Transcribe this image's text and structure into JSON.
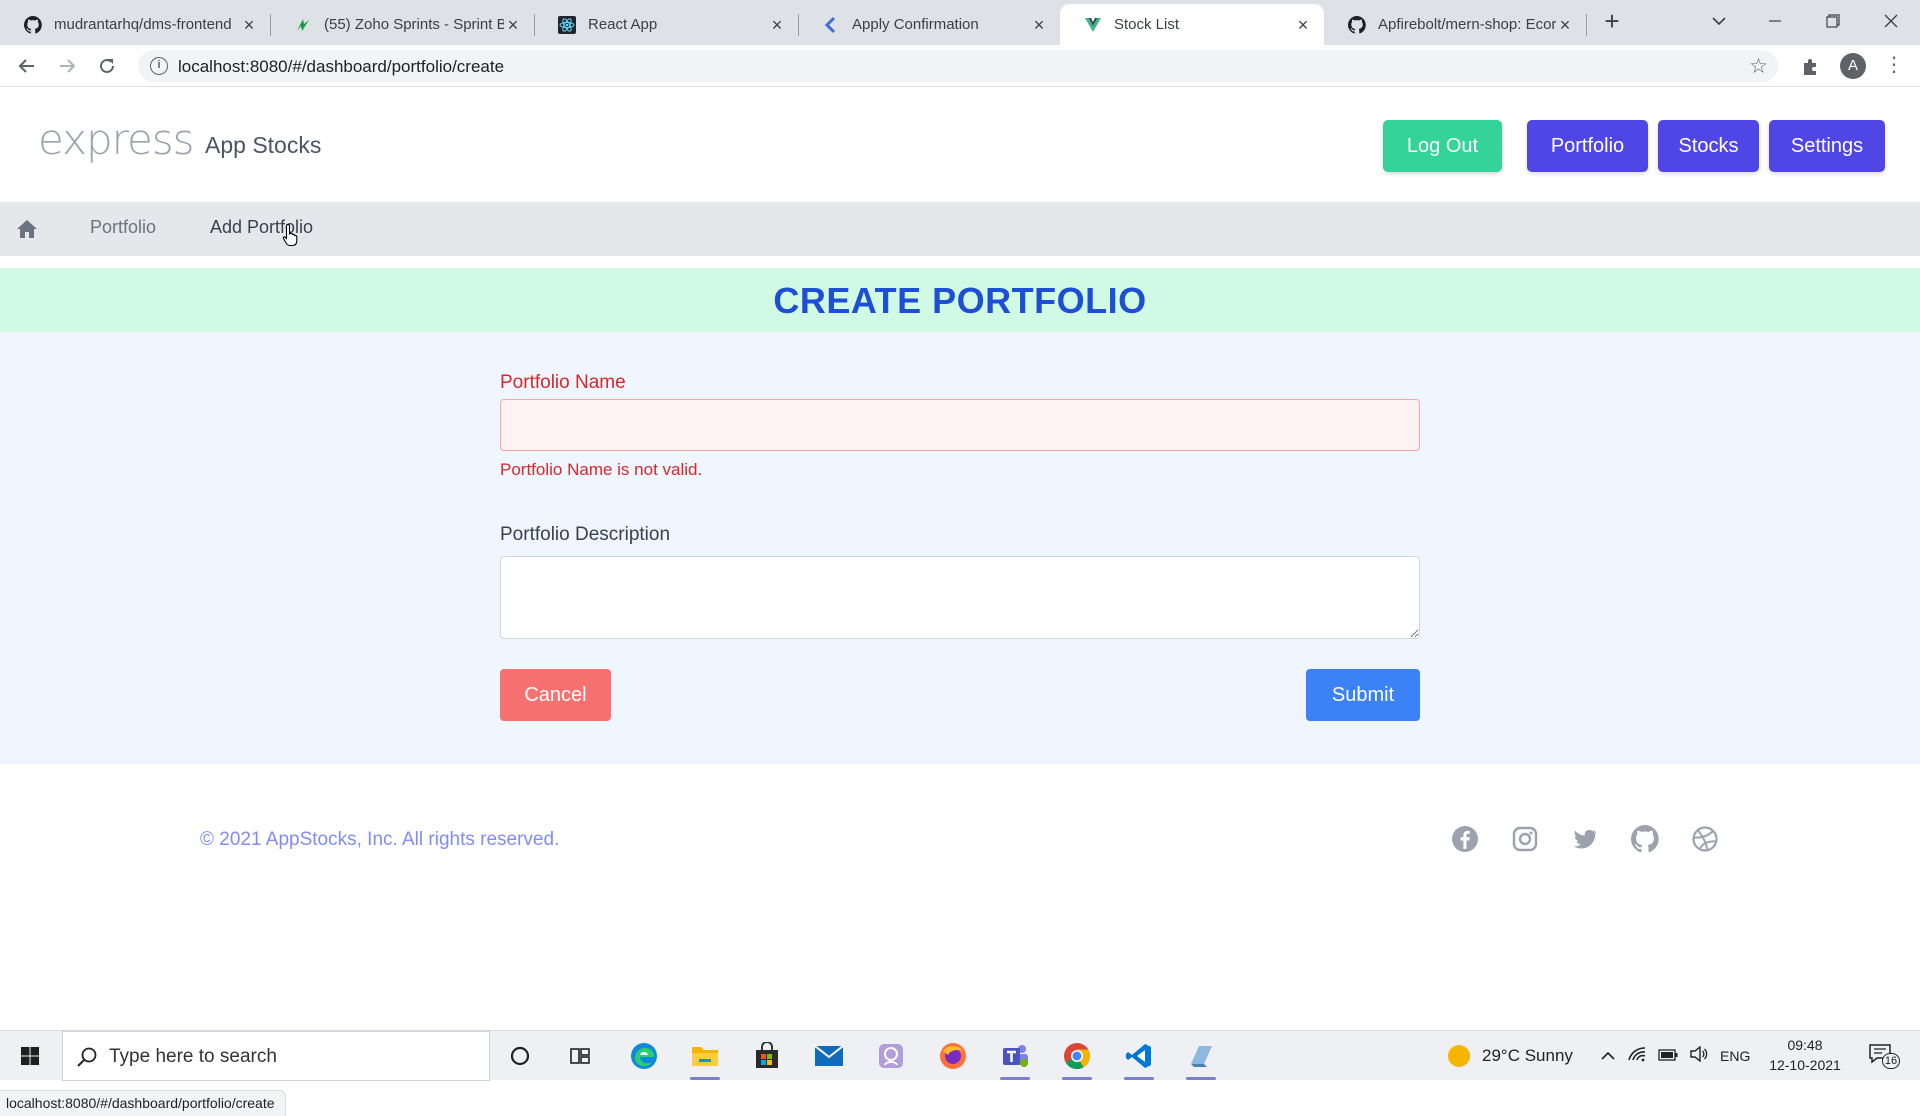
{
  "browser": {
    "tabs": [
      {
        "title": "mudrantarhq/dms-frontend",
        "icon": "github-icon"
      },
      {
        "title": "(55) Zoho Sprints - Sprint B",
        "icon": "zoho-sprints-icon"
      },
      {
        "title": "React App",
        "icon": "react-icon"
      },
      {
        "title": "Apply Confirmation",
        "icon": "kendo-icon"
      },
      {
        "title": "Stock List",
        "icon": "vue-icon",
        "active": true
      },
      {
        "title": "Apfirebolt/mern-shop: Ecor",
        "icon": "github-icon"
      }
    ],
    "url": "localhost:8080/#/dashboard/portfolio/create",
    "profile_initial": "A",
    "status_url": "localhost:8080/#/dashboard/portfolio/create"
  },
  "header": {
    "logo": "express",
    "app_name": "App Stocks",
    "buttons": {
      "logout": "Log Out",
      "portfolio": "Portfolio",
      "stocks": "Stocks",
      "settings": "Settings"
    }
  },
  "breadcrumb": {
    "items": [
      "Portfolio",
      "Add Portfolio"
    ]
  },
  "page_title": "CREATE PORTFOLIO",
  "form": {
    "name_label": "Portfolio Name",
    "name_value": "",
    "name_error": "Portfolio Name is not valid.",
    "description_label": "Portfolio Description",
    "description_value": "",
    "cancel_label": "Cancel",
    "submit_label": "Submit"
  },
  "footer": {
    "copyright": "© 2021 AppStocks, Inc. All rights reserved.",
    "social": [
      "facebook-icon",
      "instagram-icon",
      "twitter-icon",
      "github-icon",
      "dribbble-icon"
    ]
  },
  "taskbar": {
    "search_placeholder": "Type here to search",
    "weather": "29°C  Sunny",
    "language": "ENG",
    "time": "09:48",
    "date": "12-10-2021",
    "notification_count": "16"
  },
  "colors": {
    "accent_indigo": "#4f46e5",
    "logout_green": "#34d399",
    "title_blue": "#1d4ed8",
    "error_red": "#dc2626",
    "cancel_red": "#f87171",
    "submit_blue": "#3b82f6"
  }
}
